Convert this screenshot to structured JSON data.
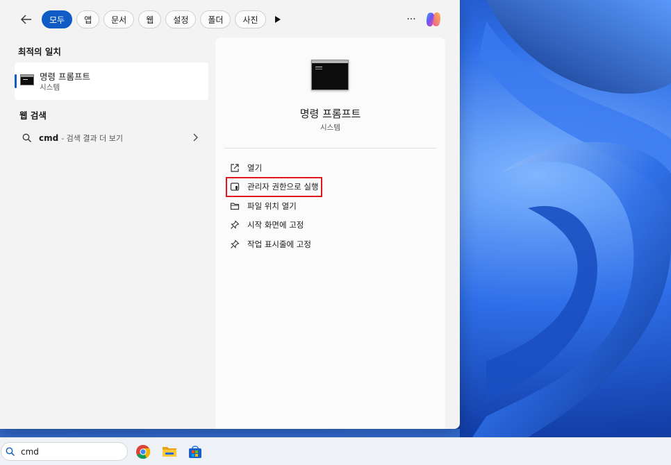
{
  "filters": {
    "back_label": "←",
    "chips": [
      "모두",
      "앱",
      "문서",
      "웹",
      "설정",
      "폴더",
      "사진"
    ],
    "more": "···"
  },
  "best_match": {
    "section": "최적의 일치",
    "name": "명령 프롬프트",
    "sub": "시스템"
  },
  "web_search": {
    "section": "웹 검색",
    "query": "cmd",
    "rest": "- 검색 결과 더 보기"
  },
  "detail": {
    "title": "명령 프롬프트",
    "sub": "시스템",
    "actions": [
      {
        "label": "열기",
        "icon": "open-external-icon"
      },
      {
        "label": "관리자 권한으로 실행",
        "icon": "shield-icon"
      },
      {
        "label": "파일 위치 열기",
        "icon": "folder-icon"
      },
      {
        "label": "시작 화면에 고정",
        "icon": "pin-icon"
      },
      {
        "label": "작업 표시줄에 고정",
        "icon": "pin-icon"
      }
    ]
  },
  "taskbar": {
    "search_value": "cmd"
  },
  "colors": {
    "accent": "#0f5cc5",
    "highlight_box": "#e0151d"
  }
}
